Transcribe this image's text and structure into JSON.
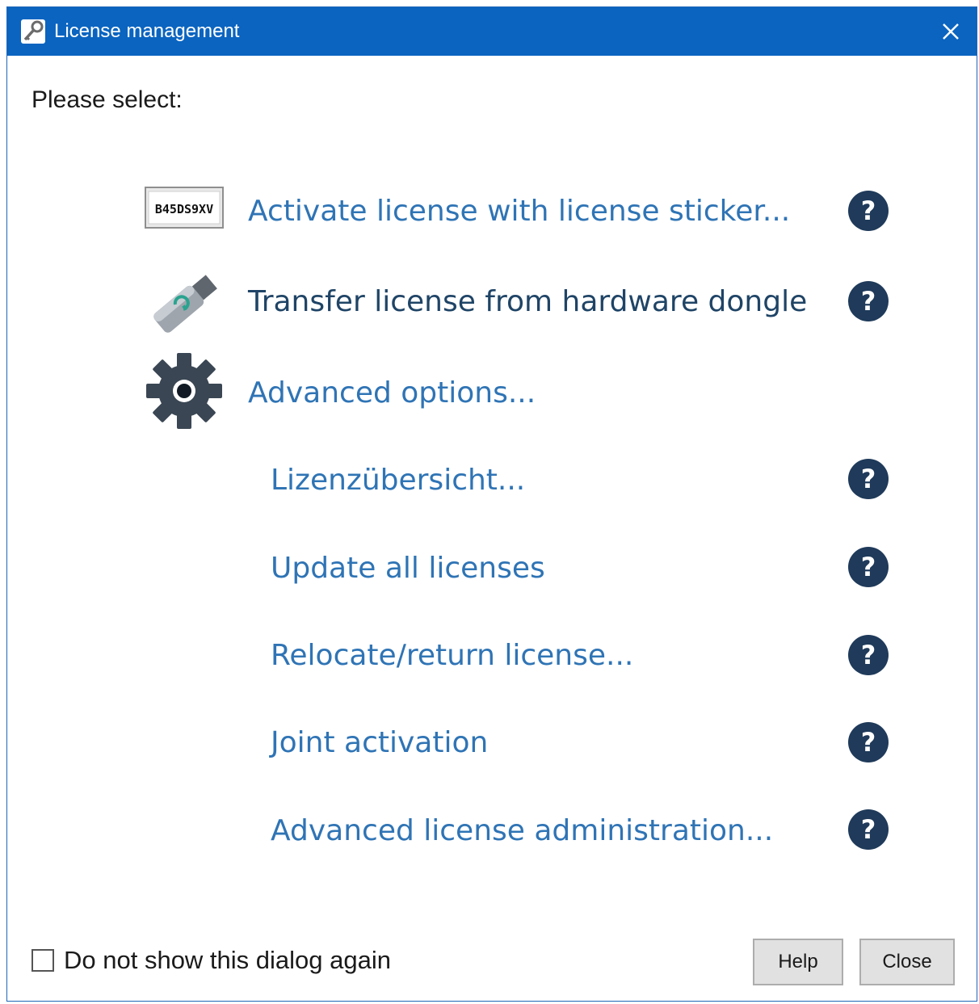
{
  "window": {
    "title": "License management",
    "titlebar_color": "#0a64c0"
  },
  "prompt": "Please select:",
  "options": [
    {
      "label": "Activate license with license sticker...",
      "icon": "license-sticker-icon",
      "sticker_text": "B45DS9XV",
      "has_help": true
    },
    {
      "label": "Transfer license from hardware dongle",
      "icon": "usb-dongle-icon",
      "has_help": true
    },
    {
      "label": "Advanced options...",
      "icon": "gear-icon",
      "has_help": false
    }
  ],
  "advanced": [
    {
      "label": "Lizenzübersicht...",
      "has_help": true
    },
    {
      "label": "Update all licenses",
      "has_help": true
    },
    {
      "label": "Relocate/return license...",
      "has_help": true
    },
    {
      "label": "Joint activation",
      "has_help": true
    },
    {
      "label": "Advanced license administration...",
      "has_help": true
    }
  ],
  "help_glyph": "?",
  "footer": {
    "checkbox_label": "Do not show this dialog again",
    "checkbox_checked": false,
    "help_button": "Help",
    "close_button": "Close"
  },
  "colors": {
    "link": "#2f74b5",
    "link_dark": "#1f4466",
    "help_circle": "#1f3a5a"
  }
}
